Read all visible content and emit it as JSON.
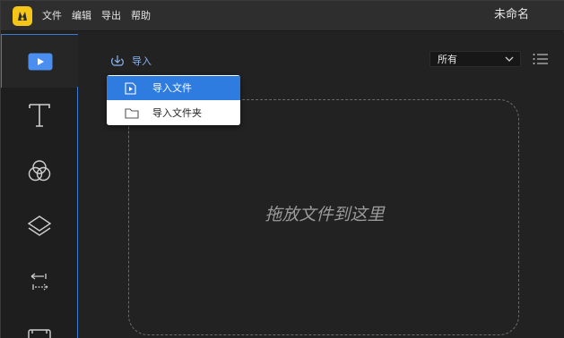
{
  "window": {
    "title": "未命名",
    "logo": "app-logo",
    "accent": "#f5c518"
  },
  "menu": {
    "items": [
      {
        "label": "文件"
      },
      {
        "label": "编辑"
      },
      {
        "label": "导出"
      },
      {
        "label": "帮助"
      }
    ]
  },
  "sidebar": {
    "items": [
      {
        "icon": "media-play-icon",
        "active": true
      },
      {
        "icon": "text-icon",
        "active": false
      },
      {
        "icon": "filters-icon",
        "active": false
      },
      {
        "icon": "overlays-icon",
        "active": false
      },
      {
        "icon": "transitions-icon",
        "active": false
      },
      {
        "icon": "elements-icon",
        "active": false
      }
    ]
  },
  "toolbar": {
    "import_label": "导入",
    "filter_value": "所有",
    "list_view_icon": "list-icon"
  },
  "dropdown": {
    "items": [
      {
        "label": "导入文件",
        "icon": "video-file-icon",
        "selected": true
      },
      {
        "label": "导入文件夹",
        "icon": "folder-icon",
        "selected": false
      }
    ],
    "highlight": "#2f7ce0"
  },
  "dropzone": {
    "label": "拖放文件到这里"
  }
}
